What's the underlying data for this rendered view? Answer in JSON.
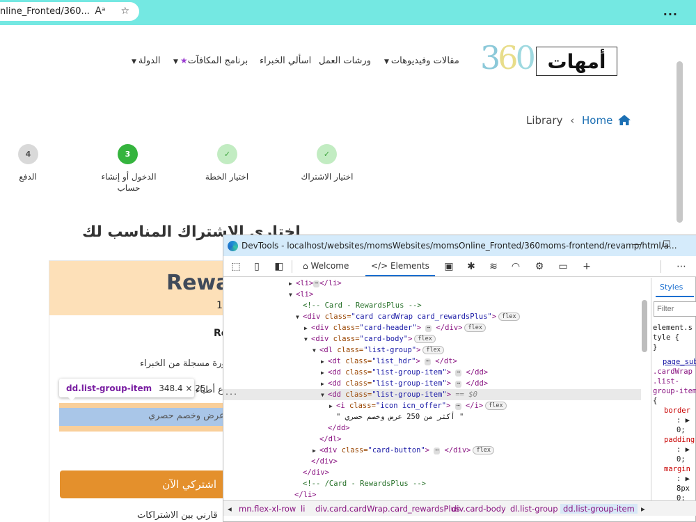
{
  "browser": {
    "url": "nline_Fronted/360...",
    "read_aloud_icon": "read-aloud-icon",
    "favorite_icon": "star-icon",
    "more_label": "..."
  },
  "site": {
    "logo_text": "أمهات",
    "logo_number": "360",
    "nav": {
      "articles": "مقالات وفيديوهات",
      "workshops": "ورشات العمل",
      "experts": "اسألي الخبراء",
      "rewards": "برنامج المكافآت",
      "country": "الدولة"
    },
    "breadcrumb": {
      "current": "Library",
      "home": "Home"
    },
    "steps": [
      {
        "marker": "✓",
        "label": "اختيار الاشتراك"
      },
      {
        "marker": "✓",
        "label": "اختيار الخطة"
      },
      {
        "marker": "3",
        "label": "الدخول أو إنشاء حساب"
      },
      {
        "marker": "4",
        "label": "الدفع"
      }
    ],
    "section_title": "اختاري الاشتراك المناسب لك",
    "card": {
      "title": "Rewa",
      "price": "10",
      "subtitle": "Re",
      "item1": "ورة مسجلة من الخبراء",
      "item2": "ع أطباء",
      "item3": "عرض وخصم حصري",
      "subscribe": "اشتركي الآن",
      "compare": "قارني بين الاشتراكات"
    },
    "tooltip": {
      "tag": "dd.list-group-item",
      "size": "348.4 × 25"
    }
  },
  "devtools": {
    "title": "DevTools - localhost/websites/momsWebsites/momsOnline_Fronted/360moms-frontend/revamp/html/a...",
    "minimize": "—",
    "maximize": "☐",
    "tabs": {
      "welcome": "Welcome",
      "elements": "Elements"
    },
    "dom": {
      "l0_open": "<li>",
      "l0_close": "</li>",
      "l1": "<li>",
      "l2": "<!-- Card - RewardsPlus -->",
      "l3_tag": "<div ",
      "l3_attr": "class=",
      "l3_val": "\"card cardWrap card_rewardsPlus\"",
      "l3_end": ">",
      "l4_tag": "<div ",
      "l4_attr": "class=",
      "l4_val": "\"card-header\"",
      "l4_end": "> ",
      "l4_close": " </div>",
      "l5_tag": "<div ",
      "l5_attr": "class=",
      "l5_val": "\"card-body\"",
      "l5_end": ">",
      "l6_tag": "<dl ",
      "l6_attr": "class=",
      "l6_val": "\"list-group\"",
      "l6_end": ">",
      "l7_tag": "<dt ",
      "l7_attr": "class=",
      "l7_val": "\"list_hdr\"",
      "l7_end": "> ",
      "l7_close": " </dt>",
      "l8_tag": "<dd ",
      "l8_attr": "class=",
      "l8_val": "\"list-group-item\"",
      "l8_end": "> ",
      "l8_close": " </dd>",
      "l9_tag": "<dd ",
      "l9_attr": "class=",
      "l9_val": "\"list-group-item\"",
      "l9_end": "> ",
      "l9_close": " </dd>",
      "l10_tag": "<dd ",
      "l10_attr": "class=",
      "l10_val": "\"list-group-item\"",
      "l10_end": ">",
      "l10_dollar": " == $0",
      "l11_tag": "<i ",
      "l11_attr": "class=",
      "l11_val": "\"icon icn_offer\"",
      "l11_end": "> ",
      "l11_close": " </i>",
      "l12": "\" أكثر من 250 عرض وخصم حصري \"",
      "l13": "</dd>",
      "l14": "</dl>",
      "l15_tag": "<div ",
      "l15_attr": "class=",
      "l15_val": "\"card-button\"",
      "l15_end": "> ",
      "l15_close": " </div>",
      "l16": "</div>",
      "l17": "</div>",
      "l18": "<!-- /Card - RewardsPlus -->",
      "l19": "</li>",
      "flex": "flex",
      "ell": "⋯",
      "side_dots": "..."
    },
    "styles": {
      "tab": "Styles",
      "filter": "Filter",
      "lines": [
        "element.s",
        "tyle {",
        "}",
        "page_sub",
        ".cardWrap",
        ".list-",
        "group-item",
        "{",
        "border",
        ": ▶",
        "0;",
        "padding",
        ": ▶",
        "0;",
        "margin",
        ": ▶",
        "8px",
        "0;",
        "}"
      ]
    },
    "crumbs": [
      "mn.flex-xl-row",
      "li",
      "div.card.cardWrap.card_rewardsPlus",
      "div.card-body",
      "dl.list-group",
      "dd.list-group-item"
    ],
    "crumb_left_arrow": "◂",
    "crumb_right_arrow": "▸"
  }
}
